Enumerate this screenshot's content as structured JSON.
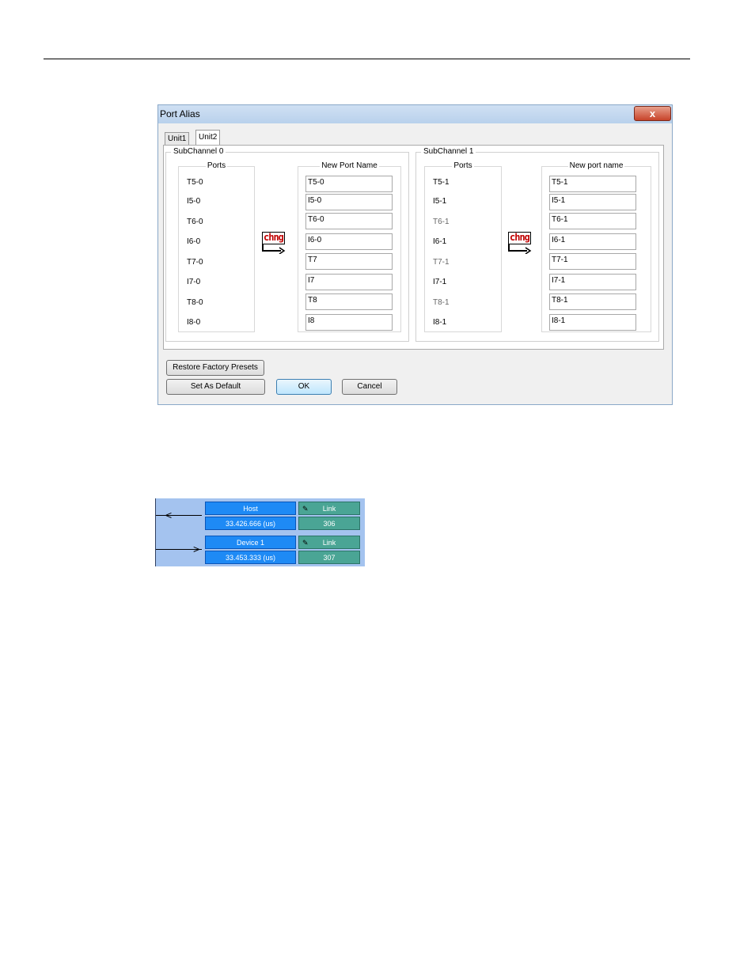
{
  "dialog": {
    "title": "Port Alias",
    "close_label": "x",
    "tabs": [
      {
        "label": "Unit1",
        "active": false
      },
      {
        "label": "Unit2",
        "active": true
      }
    ],
    "subchannels": [
      {
        "label": "SubChannel 0",
        "ports_header": "Ports",
        "names_header": "New Port Name",
        "ports": [
          "T5-0",
          "I5-0",
          "T6-0",
          "I6-0",
          "T7-0",
          "I7-0",
          "T8-0",
          "I8-0"
        ],
        "names": [
          "T5-0",
          "I5-0",
          "T6-0",
          "I6-0",
          "T7",
          "I7",
          "T8",
          "I8"
        ],
        "change_label": "chng"
      },
      {
        "label": "SubChannel 1",
        "ports_header": "Ports",
        "names_header": "New port name",
        "ports": [
          "T5-1",
          "I5-1",
          "T6-1",
          "I6-1",
          "T7-1",
          "I7-1",
          "T8-1",
          "I8-1"
        ],
        "names": [
          "T5-1",
          "I5-1",
          "T6-1",
          "I6-1",
          "T7-1",
          "I7-1",
          "T8-1",
          "I8-1"
        ],
        "change_label": "chng"
      }
    ],
    "buttons": {
      "restore": "Restore Factory Presets",
      "set_default": "Set As Default",
      "ok": "OK",
      "cancel": "Cancel"
    }
  },
  "trace": {
    "rows": [
      {
        "device": "Host",
        "time": "33.426.666 (us)",
        "type": "Link",
        "value": "306",
        "direction": "left"
      },
      {
        "device": "Device 1",
        "time": "33.453.333 (us)",
        "type": "Link",
        "value": "307",
        "direction": "right"
      }
    ],
    "colors": {
      "blue": "#1e8af5",
      "teal": "#4aa595",
      "background": "#a4c3ef"
    }
  }
}
